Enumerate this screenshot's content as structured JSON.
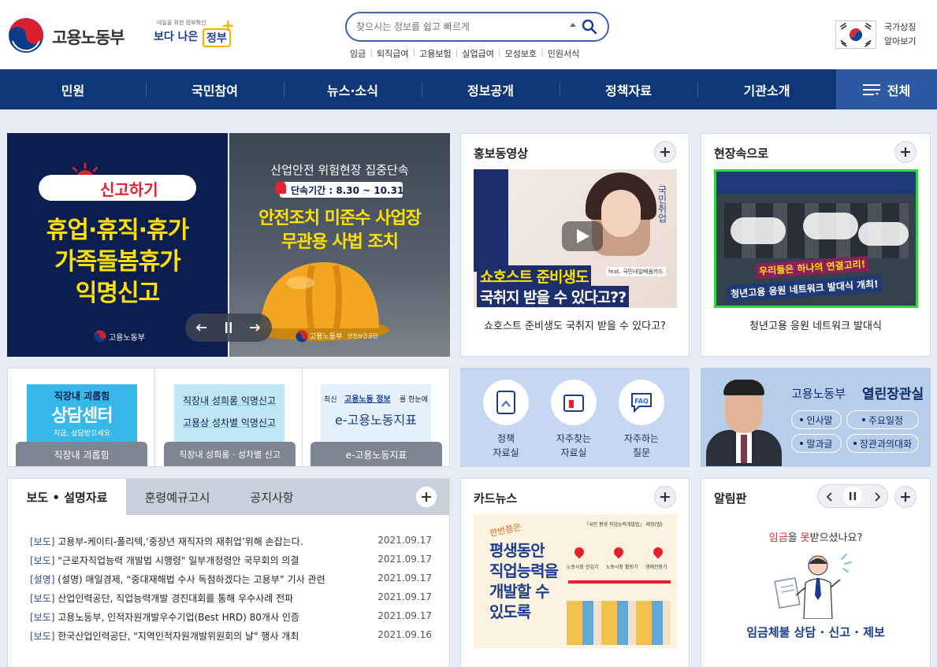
{
  "header": {
    "logo_text": "고용노동부",
    "slogan_small": "내일을 위한 정부혁신",
    "slogan_main_a": "보다 나은",
    "slogan_main_b": "정부",
    "search_placeholder": "찾으시는 정보를 쉽고 빠르게",
    "quick_links": [
      "임금",
      "퇴직급여",
      "고용보험",
      "실업급여",
      "모성보호",
      "민원서식"
    ],
    "national_symbol_line1": "국가상징",
    "national_symbol_line2": "알아보기"
  },
  "nav": {
    "items": [
      "민원",
      "국민참여",
      "뉴스·소식",
      "정보공개",
      "정책자료",
      "기관소개"
    ],
    "all_label": "전체"
  },
  "banner": {
    "left": {
      "badge": "신고하기",
      "line1": "휴업·휴직·휴가",
      "line2": "가족돌봄휴가",
      "line3": "익명신고",
      "footer_logo": "고용노동부"
    },
    "right": {
      "title": "산업안전 위험현장 집중단속",
      "period": "단속기간 : 8.30 ~ 10.31",
      "line1": "안전조치 미준수 사업장",
      "line2": "무관용 사법 조치",
      "footer_logo": "고용노동부",
      "footer_partner": "안전보건공단"
    }
  },
  "video_panel": {
    "title": "홍보동영상",
    "caption": "쇼호스트 준비생도 국취지 받을 수 있다고?",
    "thumb_line1": "쇼호스트 준비생도",
    "thumb_line2": "국취지 받을 수 있다고??",
    "thumb_side": "국민취업",
    "thumb_tag": "feat. 국민내일배움카드"
  },
  "field_panel": {
    "title": "현장속으로",
    "caption": "청년고용 응원 네트워크 발대식",
    "thumb_line1": "우리들은 하나의 연결고리!",
    "thumb_line2": "청년고용 응원 네트워크 발대식 개최!"
  },
  "quick_banners": [
    {
      "title_top": "직장내 괴롭힘",
      "title_main": "상담센터",
      "sub": "지금, 상담받으세요",
      "tab": "직장내 괴롭힘"
    },
    {
      "line1": "직장내 성희롱 익명신고",
      "line2": "고용상 성차별 익명신고",
      "tab": "직장내 성희롱 · 성차별 신고"
    },
    {
      "line1_pre": "최신",
      "line1_hl": "고용노동 정보",
      "line1_post": "를 한눈에",
      "line2": "e-고용노동지표",
      "tab": "e-고용노동지표"
    }
  ],
  "icon_links": [
    {
      "line1": "정책",
      "line2": "자료실"
    },
    {
      "line1": "자주찾는",
      "line2": "자료실"
    },
    {
      "line1": "자주하는",
      "line2": "질문"
    }
  ],
  "minister": {
    "title_a": "고용노동부",
    "title_b": "열린장관실",
    "buttons": [
      "인사말",
      "주요일정",
      "말과글",
      "장관과의대화"
    ]
  },
  "news": {
    "tabs": [
      "보도 • 설명자료",
      "훈령예규고시",
      "공지사항"
    ],
    "rows": [
      {
        "cat": "[보도]",
        "text": " 고용부-케이티-폴리텍,‘중장년 재직자의 재취업’위해 손잡는다.",
        "date": "2021.09.17"
      },
      {
        "cat": "[보도]",
        "text": " \"근로자직업능력 개발법 시행령\" 일부개정령안 국무회의 의결",
        "date": "2021.09.17"
      },
      {
        "cat": "[설명]",
        "text": " (설명) 매일경제, “중대재해법 수사 독점하겠다는 고용부” 기사 관련",
        "date": "2021.09.17"
      },
      {
        "cat": "[보도]",
        "text": " 산업인력공단, 직업능력개발 경진대회를 통해 우수사례 전파",
        "date": "2021.09.17"
      },
      {
        "cat": "[보도]",
        "text": " 고용노동부, 인적자원개발우수기업(Best HRD) 80개사 인증",
        "date": "2021.09.17"
      },
      {
        "cat": "[보도]",
        "text": " 한국산업인력공단, \"지역인적자원개발위원회의 날\" 행사 개최",
        "date": "2021.09.16"
      }
    ]
  },
  "card_news": {
    "title": "카드뉴스",
    "line1": "평생동안",
    "line2": "직업능력을",
    "line3": "개발할 수",
    "line4": "있도록",
    "stamp": "한번쯤은",
    "top_banner": "「국민 평생 직업능력개발법」 제정(법)",
    "step1": "노동시장 진입기",
    "step2": "노동시장 활동기",
    "step3": "생애전환기"
  },
  "notice": {
    "title": "알림판",
    "question_hl1": "임금",
    "question_mid": "을 ",
    "question_hl2": "못",
    "question_end": "받으셨나요?",
    "footer": "임금체불 상담 · 신고 · 제보"
  },
  "colors": {
    "nav_bg": "#0f3677",
    "nav_all_bg": "#2d59a3",
    "accent_blue": "#2a4aa0",
    "banner_yellow": "#ffe100",
    "red": "#e4222f",
    "minister_bg": "#b8cde9",
    "icon_panel_bg": "#c6d7f2"
  }
}
